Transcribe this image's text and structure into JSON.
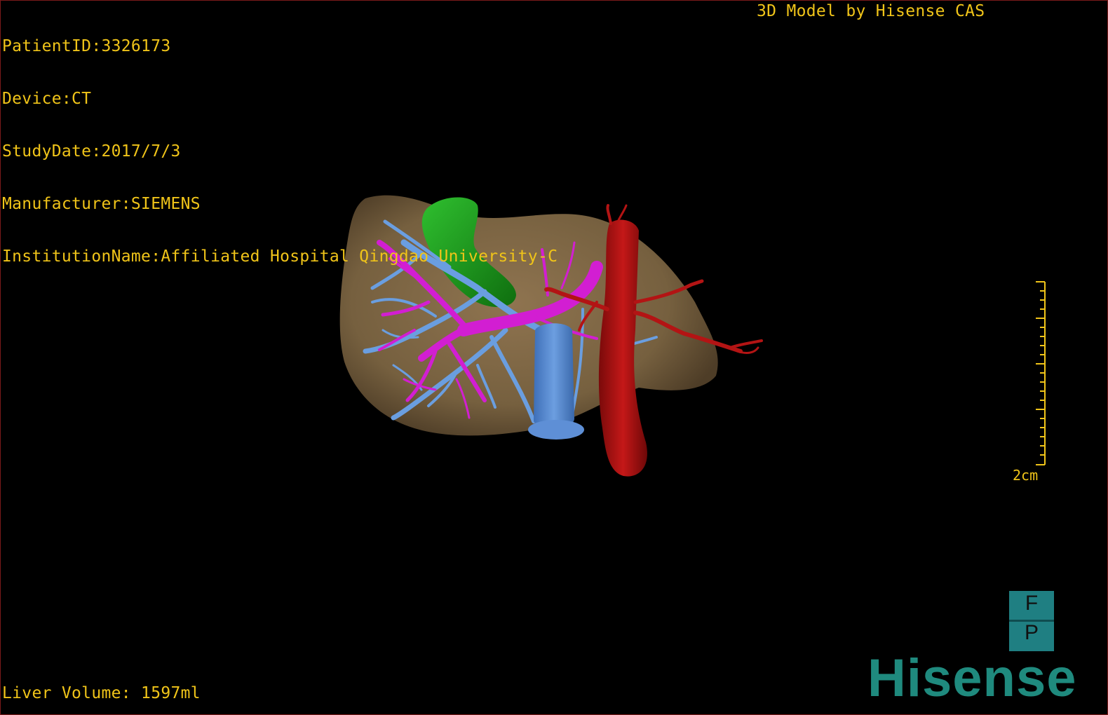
{
  "info": {
    "patient_id": "PatientID:3326173",
    "device": "Device:CT",
    "study_date": "StudyDate:2017/7/3",
    "manufacturer": "Manufacturer:SIEMENS",
    "institution": "InstitutionName:Affiliated Hospital Qingdao University-C"
  },
  "model_credit": "3D Model by Hisense CAS",
  "liver_volume": "Liver Volume: 1597ml",
  "scale_label": "2cm",
  "orientation": {
    "top": "F",
    "bottom": "P"
  },
  "brand": "Hisense",
  "colors": {
    "overlay_text": "#f0c419",
    "liver": "#7d6444",
    "gallbladder": "#1f9a1f",
    "portal_vein": "#d21ed2",
    "hepatic_vein": "#6a9ee0",
    "ivc": "#5e8fd6",
    "artery": "#b31414",
    "brand": "#1f8a7e",
    "orientation_cube": "#1f7f82"
  }
}
